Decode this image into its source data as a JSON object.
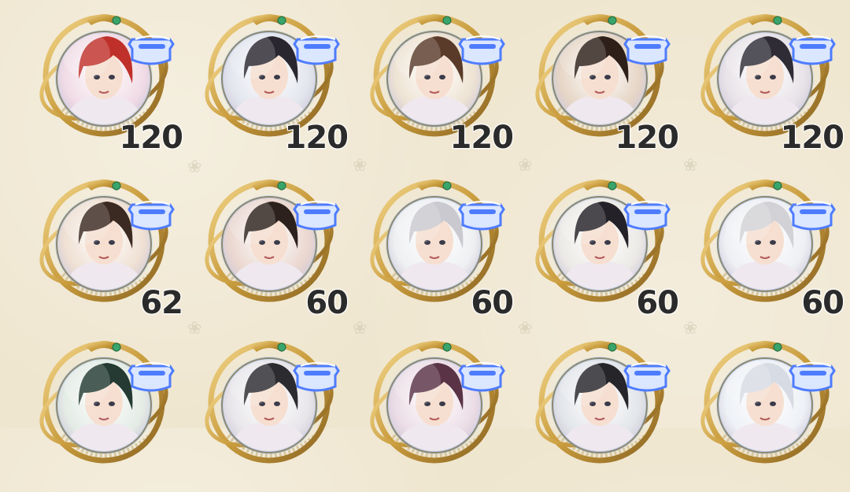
{
  "inventory": {
    "rows": [
      {
        "items": [
          {
            "name": "portrait-red-hair",
            "count": "120",
            "hair": "#c0302a",
            "bg": "#f1dce6"
          },
          {
            "name": "portrait-black-hair-ornament",
            "count": "120",
            "hair": "#2a2630",
            "bg": "#e3e6ee"
          },
          {
            "name": "portrait-brown-hair-woman",
            "count": "120",
            "hair": "#5a3b2a",
            "bg": "#eee3d3"
          },
          {
            "name": "portrait-mustache-man",
            "count": "120",
            "hair": "#2e1f19",
            "bg": "#e6d6c6"
          },
          {
            "name": "portrait-dark-hair-elegant",
            "count": "120",
            "hair": "#2f2c36",
            "bg": "#e8e3e8"
          }
        ]
      },
      {
        "items": [
          {
            "name": "portrait-blindfold",
            "count": "62",
            "hair": "#3b2a22",
            "bg": "#efe0d3"
          },
          {
            "name": "portrait-tan-dark-hair",
            "count": "60",
            "hair": "#2c211c",
            "bg": "#ead7cf"
          },
          {
            "name": "portrait-silver-hair",
            "count": "60",
            "hair": "#c9c9cf",
            "bg": "#eef0f2"
          },
          {
            "name": "portrait-wavy-dark-hair",
            "count": "60",
            "hair": "#242228",
            "bg": "#eceae6"
          },
          {
            "name": "portrait-white-hair-man",
            "count": "60",
            "hair": "#d2d2d6",
            "bg": "#eef0f4"
          }
        ]
      },
      {
        "items": [
          {
            "name": "portrait-green-hair",
            "count": "",
            "hair": "#243a33",
            "bg": "#e4ece6"
          },
          {
            "name": "portrait-black-white-hair",
            "count": "",
            "hair": "#2b2b30",
            "bg": "#e8e6ea"
          },
          {
            "name": "portrait-mauve-hair",
            "count": "",
            "hair": "#5a3346",
            "bg": "#ecdde6"
          },
          {
            "name": "portrait-dark-long-hair",
            "count": "",
            "hair": "#25252a",
            "bg": "#e3e6ea"
          },
          {
            "name": "portrait-pale-hair",
            "count": "",
            "hair": "#d7dbe3",
            "bg": "#eef1f6"
          }
        ]
      }
    ]
  },
  "colors": {
    "gold": "#c89b3c",
    "gold_dark": "#8a6422",
    "tag_blue": "#4e7cff",
    "gem_green": "#3aa56a"
  }
}
